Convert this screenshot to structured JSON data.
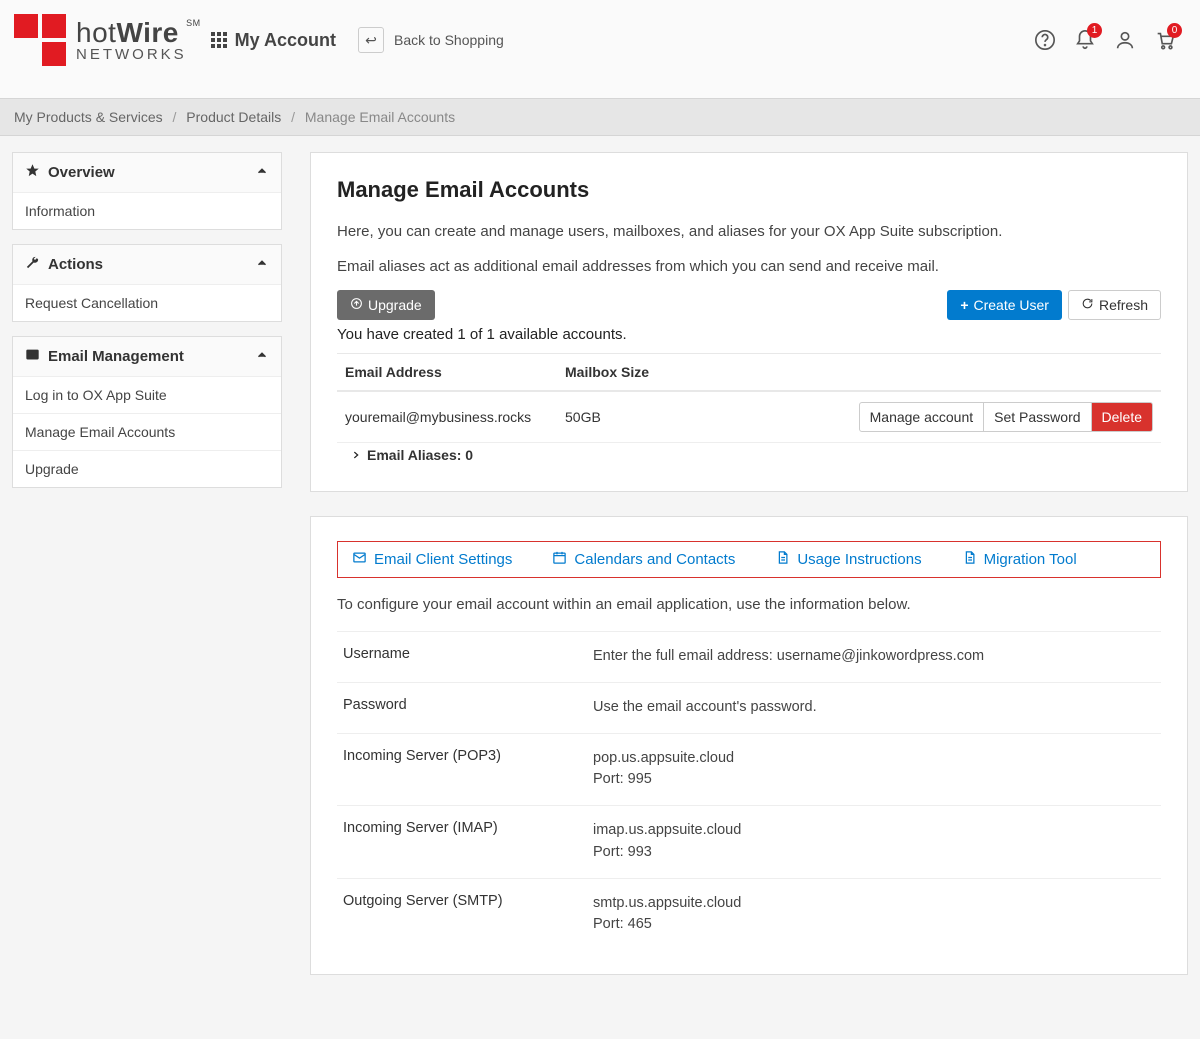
{
  "header": {
    "brand_hot": "hot",
    "brand_wire": "Wire",
    "brand_sm": "SM",
    "brand_net": "NETWORKS",
    "account_label": "My Account",
    "back_label": "Back to Shopping",
    "notif_badge": "1",
    "cart_badge": "0"
  },
  "breadcrumbs": {
    "a": "My Products & Services",
    "b": "Product Details",
    "c": "Manage Email Accounts"
  },
  "sidebar": {
    "overview": {
      "title": "Overview",
      "items": [
        "Information"
      ]
    },
    "actions": {
      "title": "Actions",
      "items": [
        "Request Cancellation"
      ]
    },
    "email": {
      "title": "Email Management",
      "items": [
        "Log in to OX App Suite",
        "Manage Email Accounts",
        "Upgrade"
      ]
    }
  },
  "main": {
    "title": "Manage Email Accounts",
    "desc1": "Here, you can create and manage users, mailboxes, and aliases for your OX App Suite subscription.",
    "desc2": "Email aliases act as additional email addresses from which you can send and receive mail.",
    "upgrade_btn": "Upgrade",
    "create_btn": "Create User",
    "refresh_btn": "Refresh",
    "count_note": "You have created 1 of 1 available accounts.",
    "col_a": "Email Address",
    "col_b": "Mailbox Size",
    "row_email": "youremail@mybusiness.rocks",
    "row_size": "50GB",
    "row_manage": "Manage account",
    "row_setpw": "Set Password",
    "row_delete": "Delete",
    "aliases_label": "Email Aliases: 0"
  },
  "tabs": {
    "a": "Email Client Settings",
    "b": "Calendars and Contacts",
    "c": "Usage Instructions",
    "d": "Migration Tool"
  },
  "config": {
    "note": "To configure your email account within an email application, use the information below.",
    "rows": [
      {
        "k": "Username",
        "v": "Enter the full email address: username@jinkowordpress.com"
      },
      {
        "k": "Password",
        "v": "Use the email account's password."
      },
      {
        "k": "Incoming Server (POP3)",
        "v": "pop.us.appsuite.cloud\nPort: 995"
      },
      {
        "k": "Incoming Server (IMAP)",
        "v": "imap.us.appsuite.cloud\nPort: 993"
      },
      {
        "k": "Outgoing Server (SMTP)",
        "v": "smtp.us.appsuite.cloud\nPort: 465"
      }
    ]
  }
}
